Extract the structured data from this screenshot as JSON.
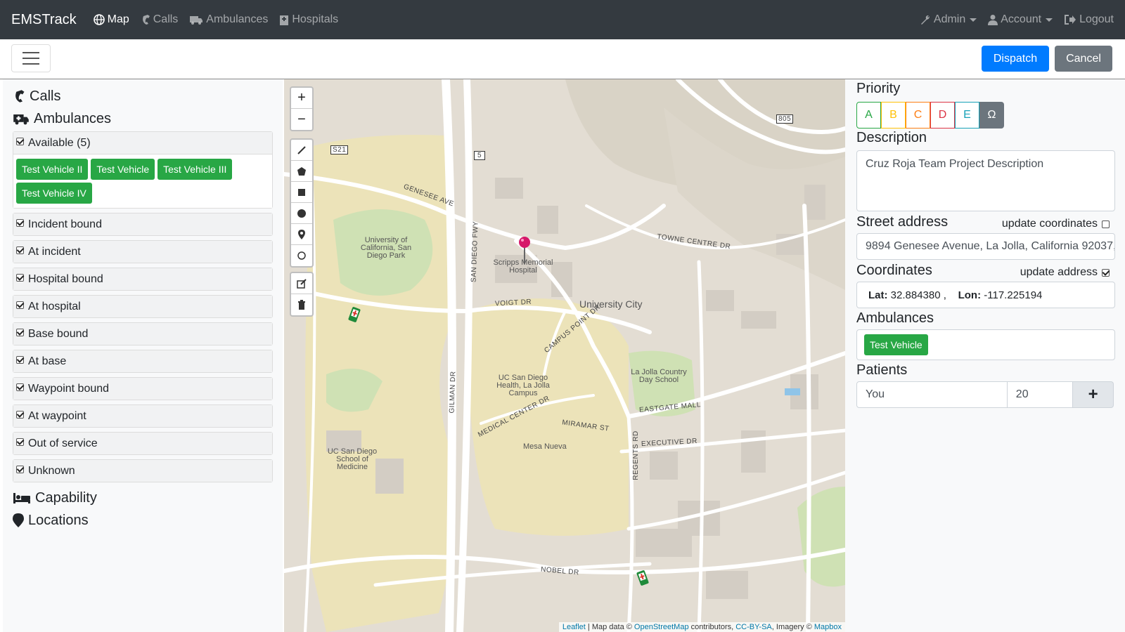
{
  "nav": {
    "brand": "EMSTrack",
    "links": [
      {
        "label": "Map",
        "icon": "globe-icon",
        "active": true
      },
      {
        "label": "Calls",
        "icon": "phone-icon",
        "active": false
      },
      {
        "label": "Ambulances",
        "icon": "ambulance-icon",
        "active": false
      },
      {
        "label": "Hospitals",
        "icon": "hospital-icon",
        "active": false
      }
    ],
    "admin_label": "Admin",
    "account_label": "Account",
    "logout_label": "Logout"
  },
  "toolbar": {
    "dispatch_label": "Dispatch",
    "cancel_label": "Cancel",
    "colors": {
      "dispatch": "#007bff",
      "cancel": "#6c757d"
    }
  },
  "sidebar": {
    "calls_label": "Calls",
    "ambulances_label": "Ambulances",
    "capability_label": "Capability",
    "locations_label": "Locations",
    "available": {
      "label": "Available (5)",
      "checked": true,
      "vehicles": [
        "Test Vehicle II",
        "Test Vehicle",
        "Test Vehicle III",
        "Test Vehicle IV"
      ]
    },
    "statuses": [
      {
        "label": "Incident bound",
        "checked": true
      },
      {
        "label": "At incident",
        "checked": true
      },
      {
        "label": "Hospital bound",
        "checked": true
      },
      {
        "label": "At hospital",
        "checked": true
      },
      {
        "label": "Base bound",
        "checked": true
      },
      {
        "label": "At base",
        "checked": true
      },
      {
        "label": "Waypoint bound",
        "checked": true
      },
      {
        "label": "At waypoint",
        "checked": true
      },
      {
        "label": "Out of service",
        "checked": true
      },
      {
        "label": "Unknown",
        "checked": true
      }
    ],
    "vehicle_color": "#28a745"
  },
  "map": {
    "zoom_in": "+",
    "zoom_out": "−",
    "attribution": {
      "leaflet": "Leaflet",
      "text1": " | Map data © ",
      "osm": "OpenStreetMap",
      "text2": " contributors, ",
      "license": "CC-BY-SA",
      "text3": ", Imagery © ",
      "mapbox": "Mapbox"
    },
    "labels": {
      "hospital": "Scripps Memorial Hospital",
      "ucsd_park": "University of California, San Diego Park",
      "univ_city": "University City",
      "health": "UC San Diego Health, La Jolla Campus",
      "med_school": "UC San Diego School of Medicine",
      "mesa": "Mesa Nueva",
      "day_school": "La Jolla Country Day School"
    },
    "streets": {
      "genesee": "GENESEE AVE",
      "voigt": "VOIGT DR",
      "campus_point": "CAMPUS POINT DR",
      "towne_centre": "TOWNE CENTRE DR",
      "eastgate": "EASTGATE MALL",
      "executive": "EXECUTIVE DR",
      "nobel": "NOBEL DR",
      "regents": "REGENTS RD",
      "miramar": "MIRAMAR ST",
      "medical_center": "MEDICAL CENTER DR",
      "gilman": "GILMAN DR",
      "sd_fwy": "SAN DIEGO FWY",
      "s21": "S21",
      "i5": "5",
      "i805": "805"
    }
  },
  "form": {
    "priority_label": "Priority",
    "priorities": [
      {
        "label": "A",
        "color": "#28a745"
      },
      {
        "label": "B",
        "color": "#ffc107"
      },
      {
        "label": "C",
        "color": "#fd7e14"
      },
      {
        "label": "D",
        "color": "#dc3545"
      },
      {
        "label": "E",
        "color": "#17a2b8"
      },
      {
        "label": "Ω",
        "color": "#6c757d"
      }
    ],
    "description_label": "Description",
    "description_value": "Cruz Roja Team Project Description",
    "street_label": "Street address",
    "update_coordinates_label": "update coordinates",
    "update_coordinates_checked": false,
    "street_value": "9894 Genesee Avenue, La Jolla, California 92037,",
    "coordinates_label": "Coordinates",
    "update_address_label": "update address",
    "update_address_checked": true,
    "lat_label": "Lat:",
    "lat_value": "32.884380",
    "lon_label": "Lon:",
    "lon_value": "-117.225194",
    "ambulances_label": "Ambulances",
    "ambulance_chip": "Test Vehicle",
    "patients_label": "Patients",
    "patient_name": "You",
    "patient_age": "20",
    "add_patient": "+"
  }
}
